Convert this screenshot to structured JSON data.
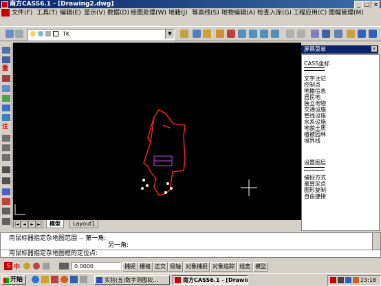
{
  "window": {
    "title": "南方CASS6.1 - [Drawing2.dwg]"
  },
  "menu": [
    "文件(F)",
    "工具(T)",
    "编辑(E)",
    "显示(V)",
    "数据(D)",
    "绘图处理(W)",
    "地籍(J)",
    "等高线(S)",
    "地物编辑(A)",
    "检查入库(G)",
    "工程应用(C)",
    "图幅管理(M)"
  ],
  "toolbar": {
    "layer_name": "TK"
  },
  "screen_menu": {
    "title": "屏幕菜单",
    "items": [
      "CASS坐标",
      "文字注记",
      "控制点",
      "地籍信息",
      "居民地",
      "独立地物",
      "交通设施",
      "管线设施",
      "水系设施",
      "境界线",
      "地貌土质",
      "植被园林"
    ],
    "items2": [
      "设置图层",
      "捕捉方式",
      "量算定点",
      "图形复制",
      "自由捷接"
    ]
  },
  "tabs": [
    "模型",
    "Layout1"
  ],
  "command": {
    "line1": "用鼠标器指定杂地图范围 -- 第一角:",
    "line2": "另一角:",
    "line3": "用鼠标器指定杂地图框的定位点:"
  },
  "status": {
    "coord": "0.0000",
    "buttons": [
      "捕捉",
      "栅格",
      "正交",
      "极轴",
      "对象捕捉",
      "对象追踪",
      "线宽",
      "模型"
    ]
  },
  "taskbar": {
    "start": "开始",
    "tasks": [
      "实验(五)数字测图软...",
      "南方CASS6.1 - [Drawing..."
    ],
    "clock": "23:18"
  },
  "left_icon_labels": {
    "zhong": "重",
    "zhu": "注"
  },
  "ime_label": "中"
}
